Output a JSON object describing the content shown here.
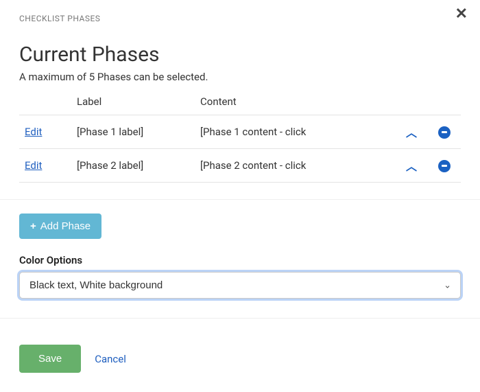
{
  "header": {
    "label": "CHECKLIST PHASES"
  },
  "title": "Current Phases",
  "subtitle": "A maximum of 5 Phases can be selected.",
  "columns": {
    "label": "Label",
    "content": "Content"
  },
  "edit_label": "Edit",
  "phases": [
    {
      "label": "[Phase 1 label]",
      "content": "[Phase 1 content - click"
    },
    {
      "label": "[Phase 2 label]",
      "content": "[Phase 2 content - click"
    }
  ],
  "add_phase_label": "Add Phase",
  "color_options": {
    "label": "Color Options",
    "selected": "Black text, White background"
  },
  "footer": {
    "save": "Save",
    "cancel": "Cancel"
  },
  "icons": {
    "close": "close-icon",
    "chevron_up": "chevron-up-icon",
    "remove": "minus-circle-icon",
    "plus": "plus-icon",
    "caret_down": "chevron-down-icon"
  }
}
